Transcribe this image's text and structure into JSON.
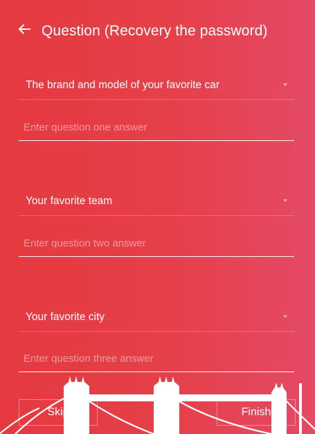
{
  "header": {
    "title": "Question (Recovery the password)",
    "back_icon": "arrow-left-icon"
  },
  "questions": [
    {
      "question": "The brand and model of your favorite car",
      "placeholder": "Enter question one answer",
      "value": ""
    },
    {
      "question": "Your favorite team",
      "placeholder": "Enter question two answer",
      "value": ""
    },
    {
      "question": "Your favorite city",
      "placeholder": "Enter question three answer",
      "value": ""
    }
  ],
  "buttons": {
    "skip": "Skip",
    "finish": "Finish"
  },
  "colors": {
    "background_start": "#e5393f",
    "background_end": "#e44a66",
    "foreground": "#ffffff"
  }
}
